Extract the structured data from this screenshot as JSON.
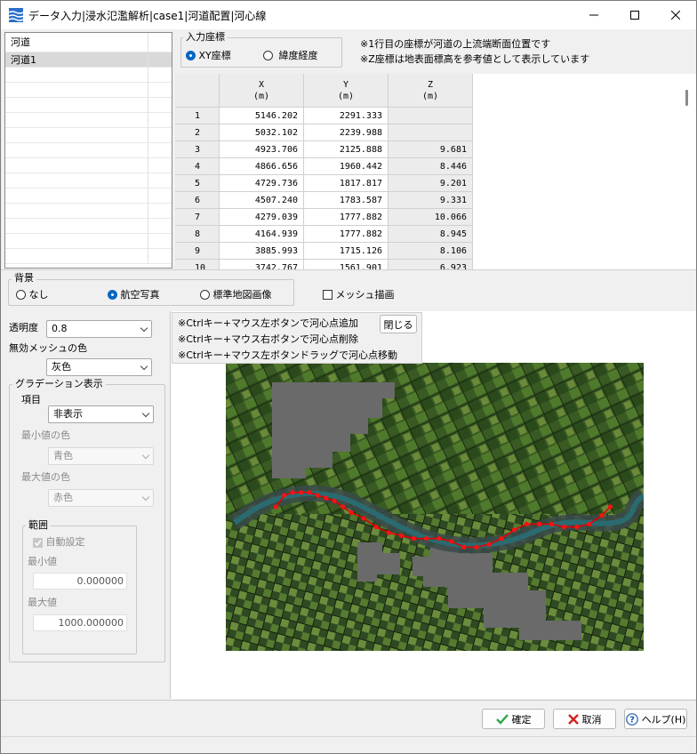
{
  "window": {
    "title": "データ入力|浸水氾濫解析|case1|河道配置|河心線",
    "controls": [
      "minimize",
      "maximize",
      "close"
    ]
  },
  "river_list": {
    "header": "河道",
    "items": [
      "河道1"
    ],
    "selected": "河道1"
  },
  "coord_input": {
    "group_label": "入力座標",
    "options": [
      "XY座標",
      "緯度経度"
    ],
    "selected": "XY座標",
    "notes": [
      "※1行目の座標が河道の上流端断面位置です",
      "※Z座標は地表面標高を参考値として表示しています"
    ]
  },
  "table": {
    "columns": [
      {
        "name": "X",
        "unit": "(m)"
      },
      {
        "name": "Y",
        "unit": "(m)"
      },
      {
        "name": "Z",
        "unit": "(m)"
      }
    ],
    "rows": [
      {
        "no": "1",
        "x": "5146.202",
        "y": "2291.333",
        "z": ""
      },
      {
        "no": "2",
        "x": "5032.102",
        "y": "2239.988",
        "z": ""
      },
      {
        "no": "3",
        "x": "4923.706",
        "y": "2125.888",
        "z": "9.681"
      },
      {
        "no": "4",
        "x": "4866.656",
        "y": "1960.442",
        "z": "8.446"
      },
      {
        "no": "5",
        "x": "4729.736",
        "y": "1817.817",
        "z": "9.201"
      },
      {
        "no": "6",
        "x": "4507.240",
        "y": "1783.587",
        "z": "9.331"
      },
      {
        "no": "7",
        "x": "4279.039",
        "y": "1777.882",
        "z": "10.066"
      },
      {
        "no": "8",
        "x": "4164.939",
        "y": "1777.882",
        "z": "8.945"
      },
      {
        "no": "9",
        "x": "3885.993",
        "y": "1715.126",
        "z": "8.106"
      },
      {
        "no": "10",
        "x": "3742.767",
        "y": "1561.901",
        "z": "6.923"
      }
    ]
  },
  "background": {
    "group_label": "背景",
    "options": [
      "なし",
      "航空写真",
      "標準地図画像"
    ],
    "selected": "航空写真",
    "mesh_draw": {
      "label": "メッシュ描画",
      "checked": false
    }
  },
  "display": {
    "opacity_label": "透明度",
    "opacity_value": "0.8",
    "invalid_mesh_color_label": "無効メッシュの色",
    "invalid_mesh_color_value": "灰色",
    "gradation": {
      "group_label": "グラデーション表示",
      "item_label": "項目",
      "item_value": "非表示",
      "min_color_label": "最小値の色",
      "min_color_value": "青色",
      "max_color_label": "最大値の色",
      "max_color_value": "赤色",
      "range": {
        "group_label": "範囲",
        "auto_label": "自動設定",
        "auto_checked": true,
        "min_label": "最小値",
        "min_value": "0.000000",
        "max_label": "最大値",
        "max_value": "1000.000000"
      }
    }
  },
  "map_hint": {
    "lines": [
      "※Ctrlキー+マウス左ボタンで河心点追加",
      "※Ctrlキー+マウス右ボタンで河心点削除",
      "※Ctrlキー+マウス左ボタンドラッグで河心点移動"
    ],
    "close_label": "閉じる"
  },
  "map": {
    "centerline_points": [
      [
        0.12,
        0.5
      ],
      [
        0.14,
        0.46
      ],
      [
        0.16,
        0.45
      ],
      [
        0.18,
        0.45
      ],
      [
        0.2,
        0.45
      ],
      [
        0.22,
        0.46
      ],
      [
        0.24,
        0.47
      ],
      [
        0.26,
        0.48
      ],
      [
        0.28,
        0.5
      ],
      [
        0.3,
        0.52
      ],
      [
        0.33,
        0.54
      ],
      [
        0.36,
        0.57
      ],
      [
        0.39,
        0.59
      ],
      [
        0.42,
        0.6
      ],
      [
        0.45,
        0.61
      ],
      [
        0.48,
        0.61
      ],
      [
        0.51,
        0.61
      ],
      [
        0.54,
        0.62
      ],
      [
        0.57,
        0.64
      ],
      [
        0.6,
        0.64
      ],
      [
        0.63,
        0.63
      ],
      [
        0.66,
        0.61
      ],
      [
        0.69,
        0.58
      ],
      [
        0.72,
        0.56
      ],
      [
        0.75,
        0.56
      ],
      [
        0.78,
        0.56
      ],
      [
        0.81,
        0.57
      ],
      [
        0.84,
        0.57
      ],
      [
        0.87,
        0.56
      ],
      [
        0.9,
        0.53
      ],
      [
        0.92,
        0.5
      ]
    ],
    "point_color": "#ff1010",
    "line_color": "#e00000"
  },
  "footer": {
    "ok_label": "確定",
    "cancel_label": "取消",
    "help_label": "ヘルプ(H)"
  },
  "colors": {
    "accent": "#0067c0",
    "ok_check": "#2aa84a",
    "cancel_x": "#d42020",
    "help_icon": "#1e5aa8"
  }
}
